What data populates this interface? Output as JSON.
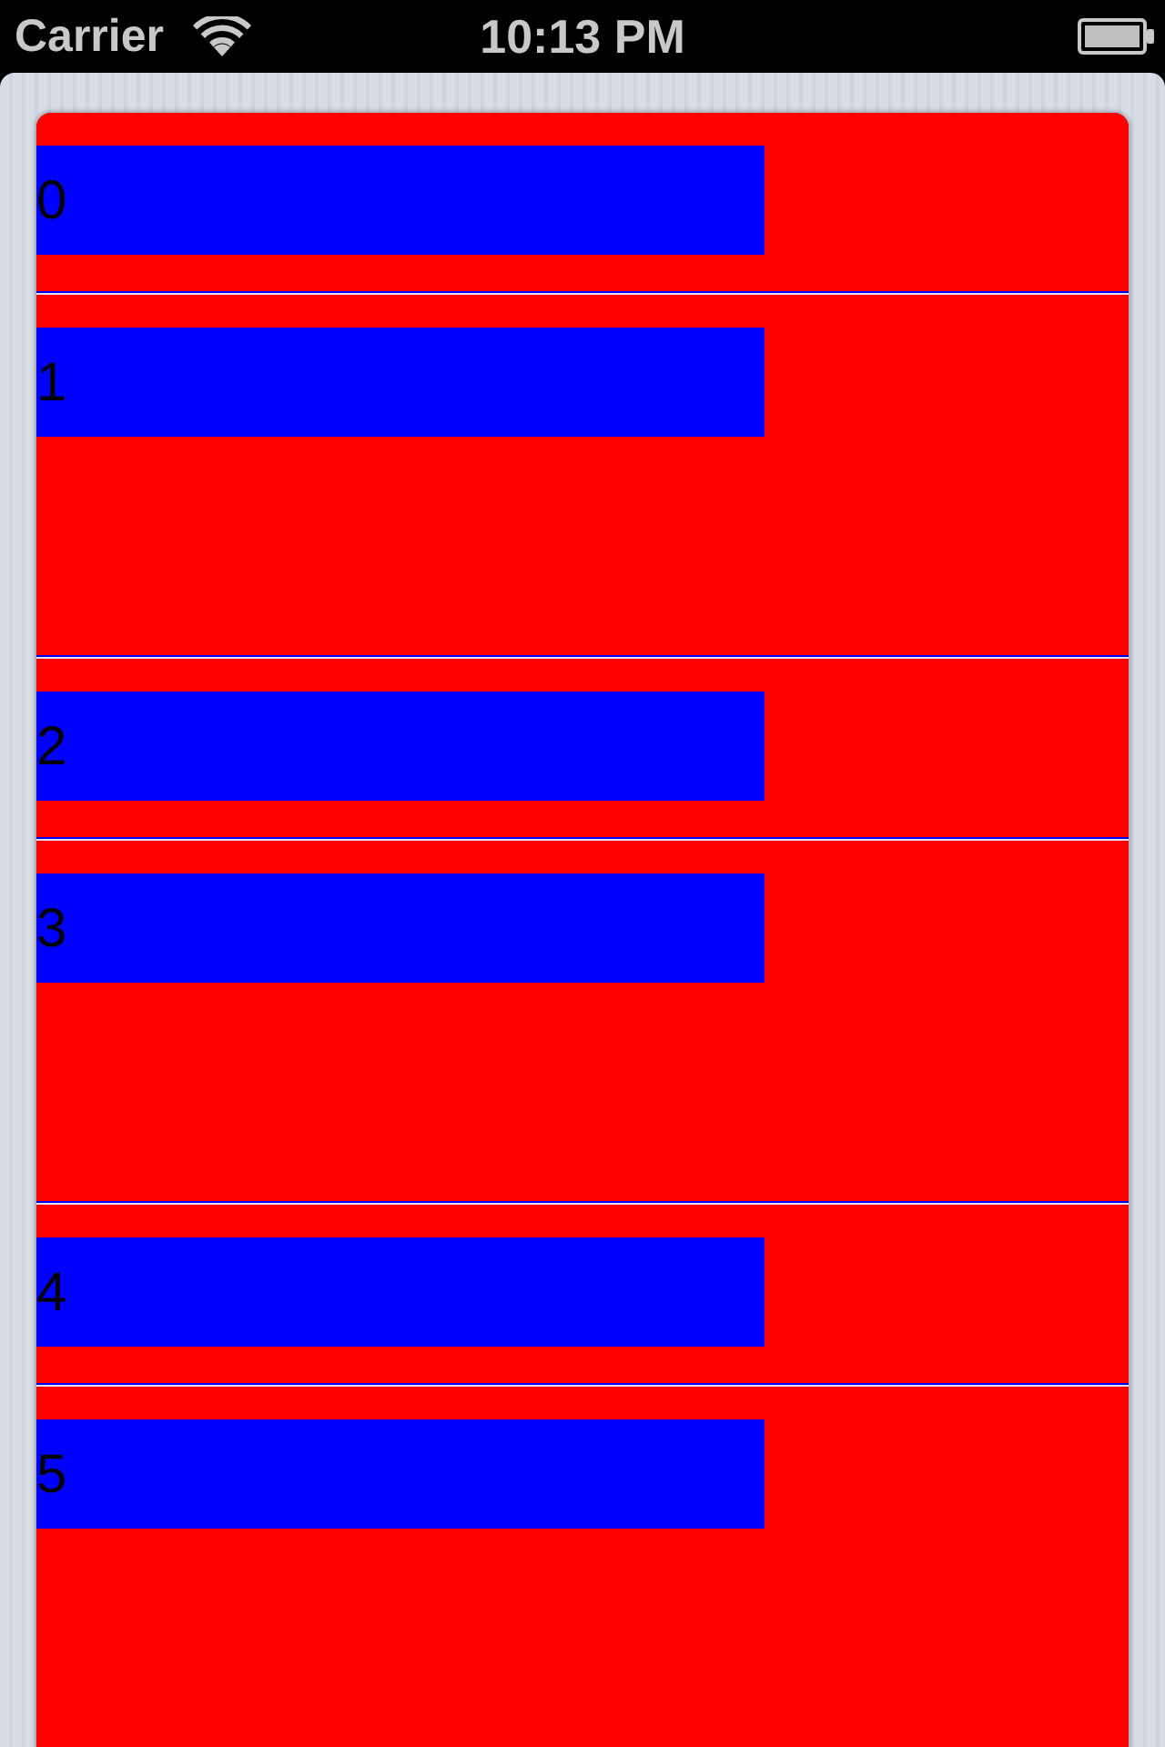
{
  "status_bar": {
    "carrier": "Carrier",
    "time": "10:13 PM"
  },
  "table": {
    "rows": [
      {
        "label": "0",
        "kind": "short"
      },
      {
        "label": "1",
        "kind": "tall"
      },
      {
        "label": "2",
        "kind": "short"
      },
      {
        "label": "3",
        "kind": "tall"
      },
      {
        "label": "4",
        "kind": "short"
      },
      {
        "label": "5",
        "kind": "tall"
      }
    ]
  }
}
